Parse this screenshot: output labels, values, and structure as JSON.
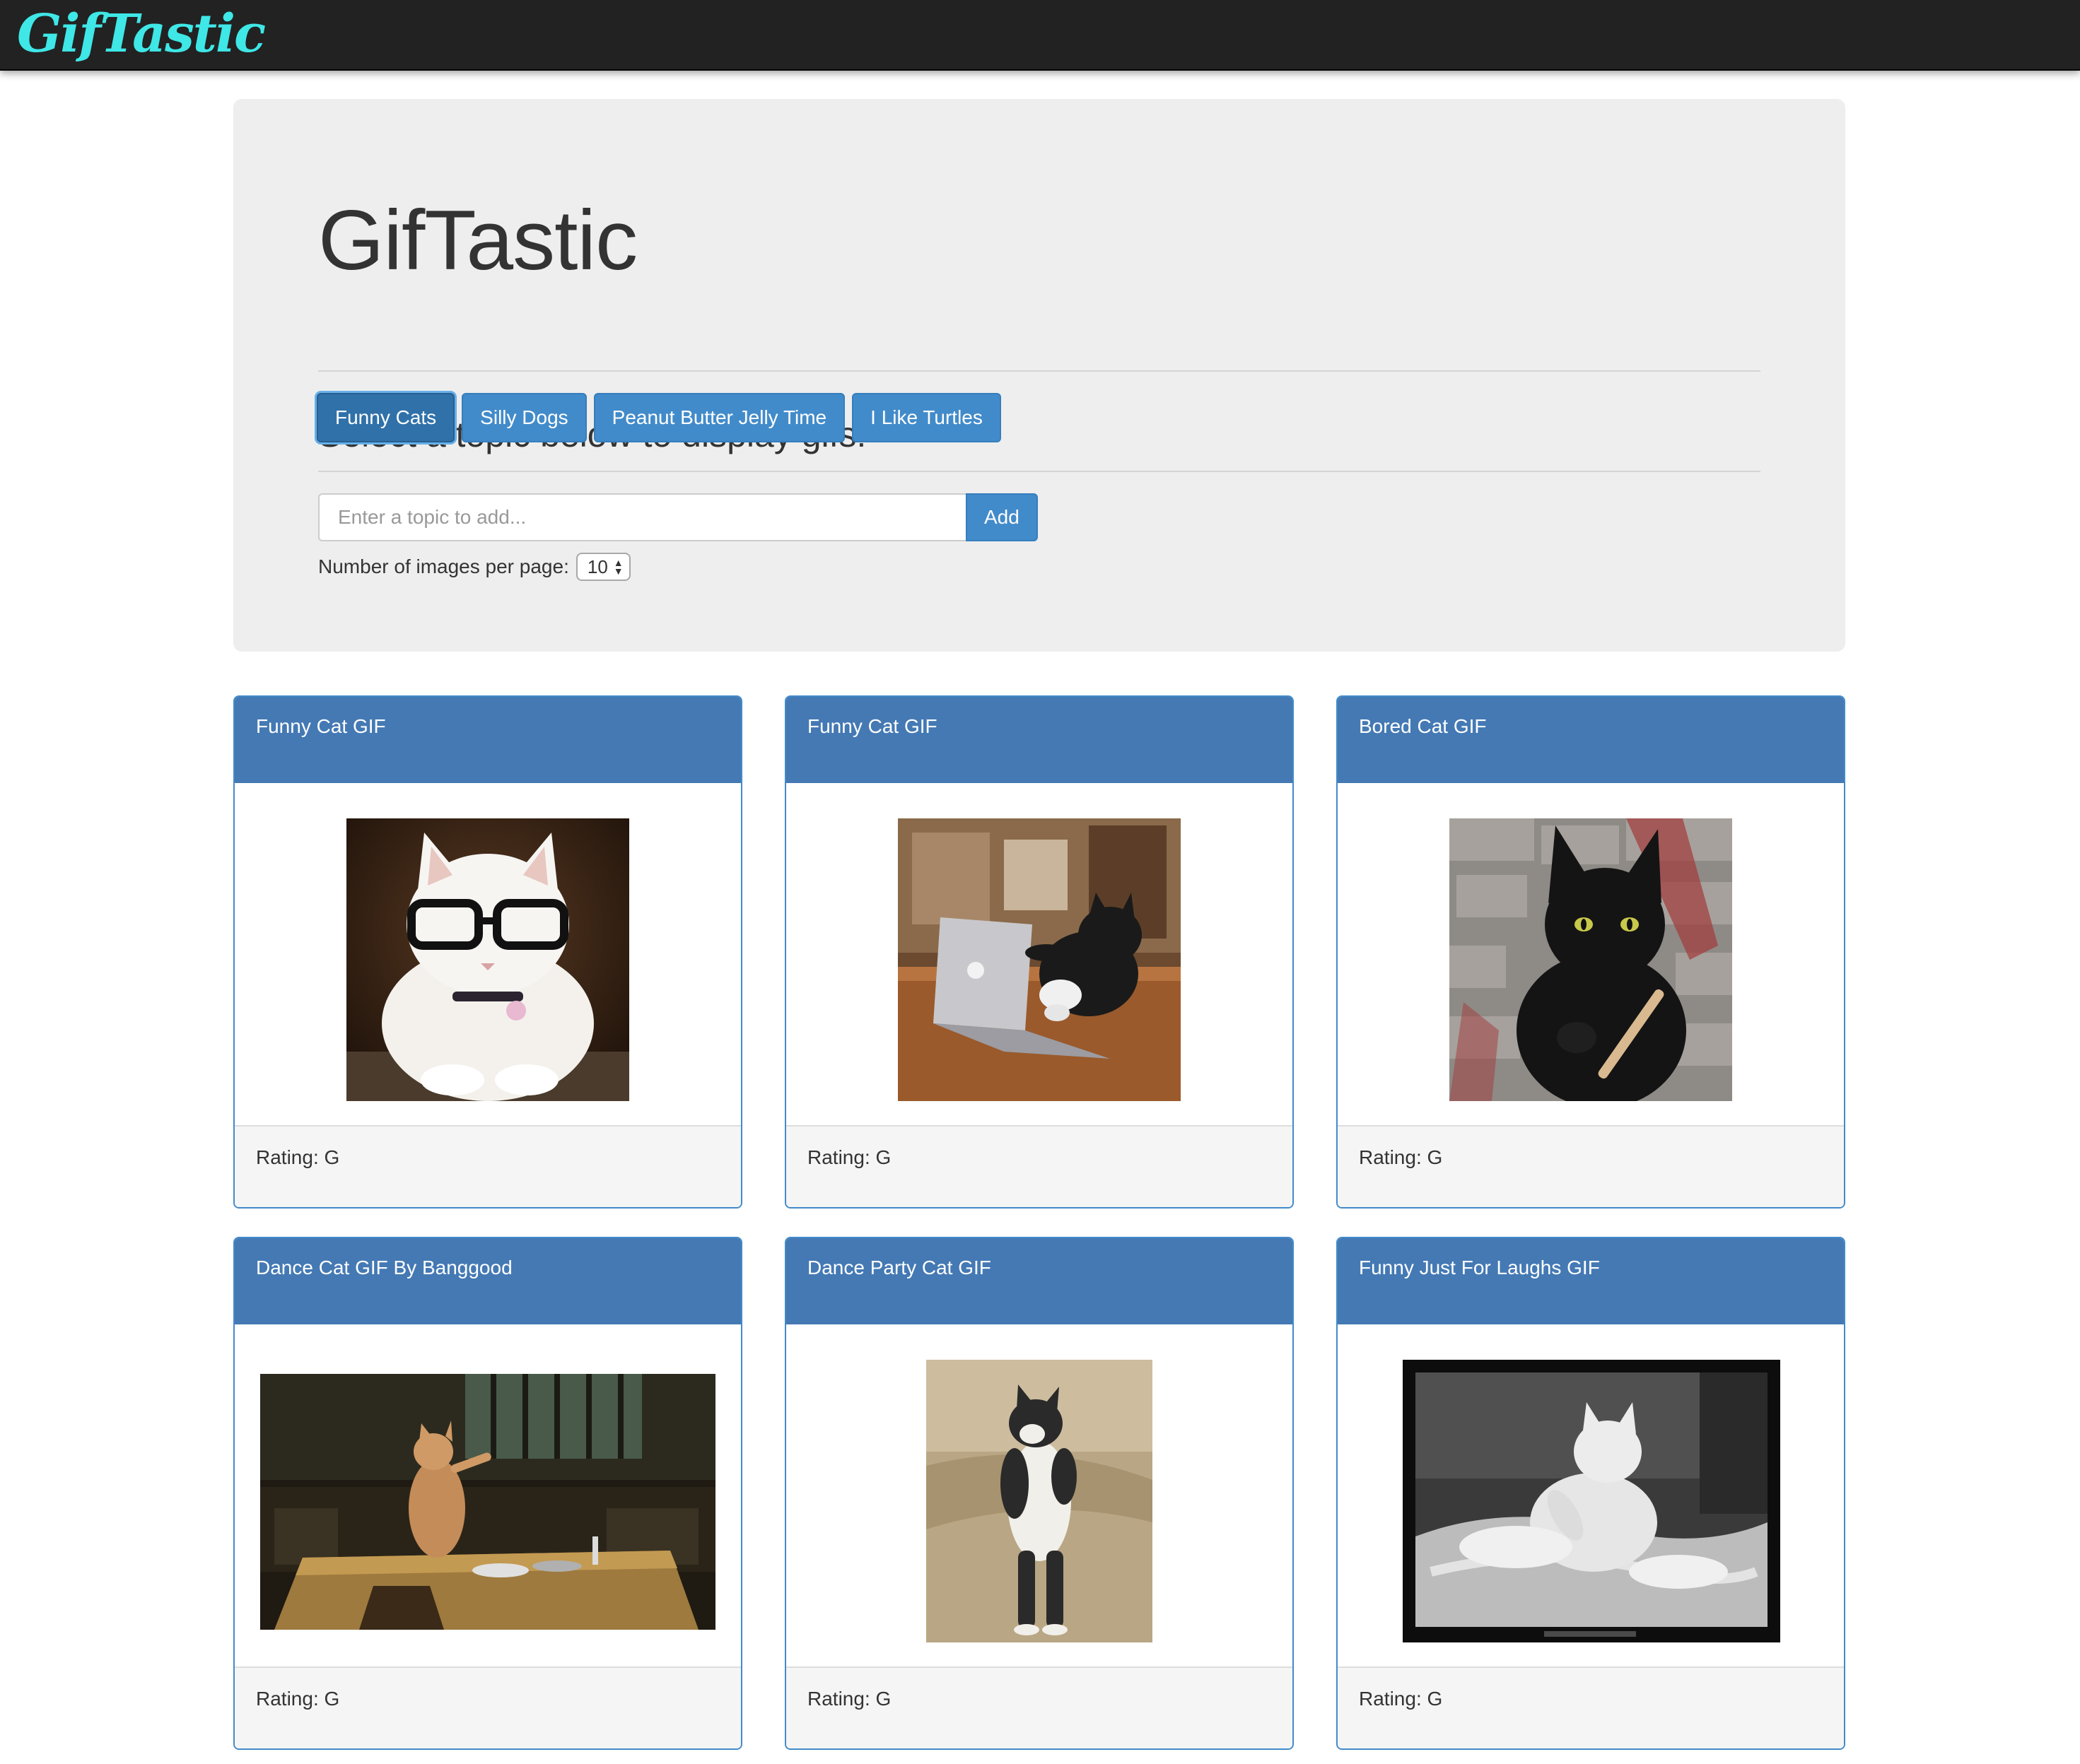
{
  "navbar": {
    "brand": "GifTastic"
  },
  "jumbotron": {
    "title": "GifTastic",
    "subtitle": "Select a topic below to display gifs!",
    "topics": [
      {
        "label": "Funny Cats",
        "active": true
      },
      {
        "label": "Silly Dogs",
        "active": false
      },
      {
        "label": "Peanut Butter Jelly Time",
        "active": false
      },
      {
        "label": "I Like Turtles",
        "active": false
      }
    ],
    "add_form": {
      "placeholder": "Enter a topic to add...",
      "value": "",
      "button_label": "Add"
    },
    "per_page": {
      "label": "Number of images per page:",
      "selected": "10"
    }
  },
  "colors": {
    "brand_text": "#3fe7e7",
    "navbar_bg": "#222222",
    "primary": "#428bca",
    "card_heading": "#4479b4",
    "jumbotron_bg": "#eeeeee"
  },
  "gifs": [
    {
      "title": "Funny Cat GIF",
      "rating": "Rating: G",
      "image": "white cat wearing glasses"
    },
    {
      "title": "Funny Cat GIF",
      "rating": "Rating: G",
      "image": "black and white cat typing on laptop"
    },
    {
      "title": "Bored Cat GIF",
      "rating": "Rating: G",
      "image": "black cat filing nails"
    },
    {
      "title": "Dance Cat GIF By Banggood",
      "rating": "Rating: G",
      "image": "ginger cat dancing on kitchen table"
    },
    {
      "title": "Dance Party Cat GIF",
      "rating": "Rating: G",
      "image": "cat standing upright dancing"
    },
    {
      "title": "Funny Just For Laughs GIF",
      "rating": "Rating: G",
      "image": "white cat on bed black and white"
    }
  ]
}
